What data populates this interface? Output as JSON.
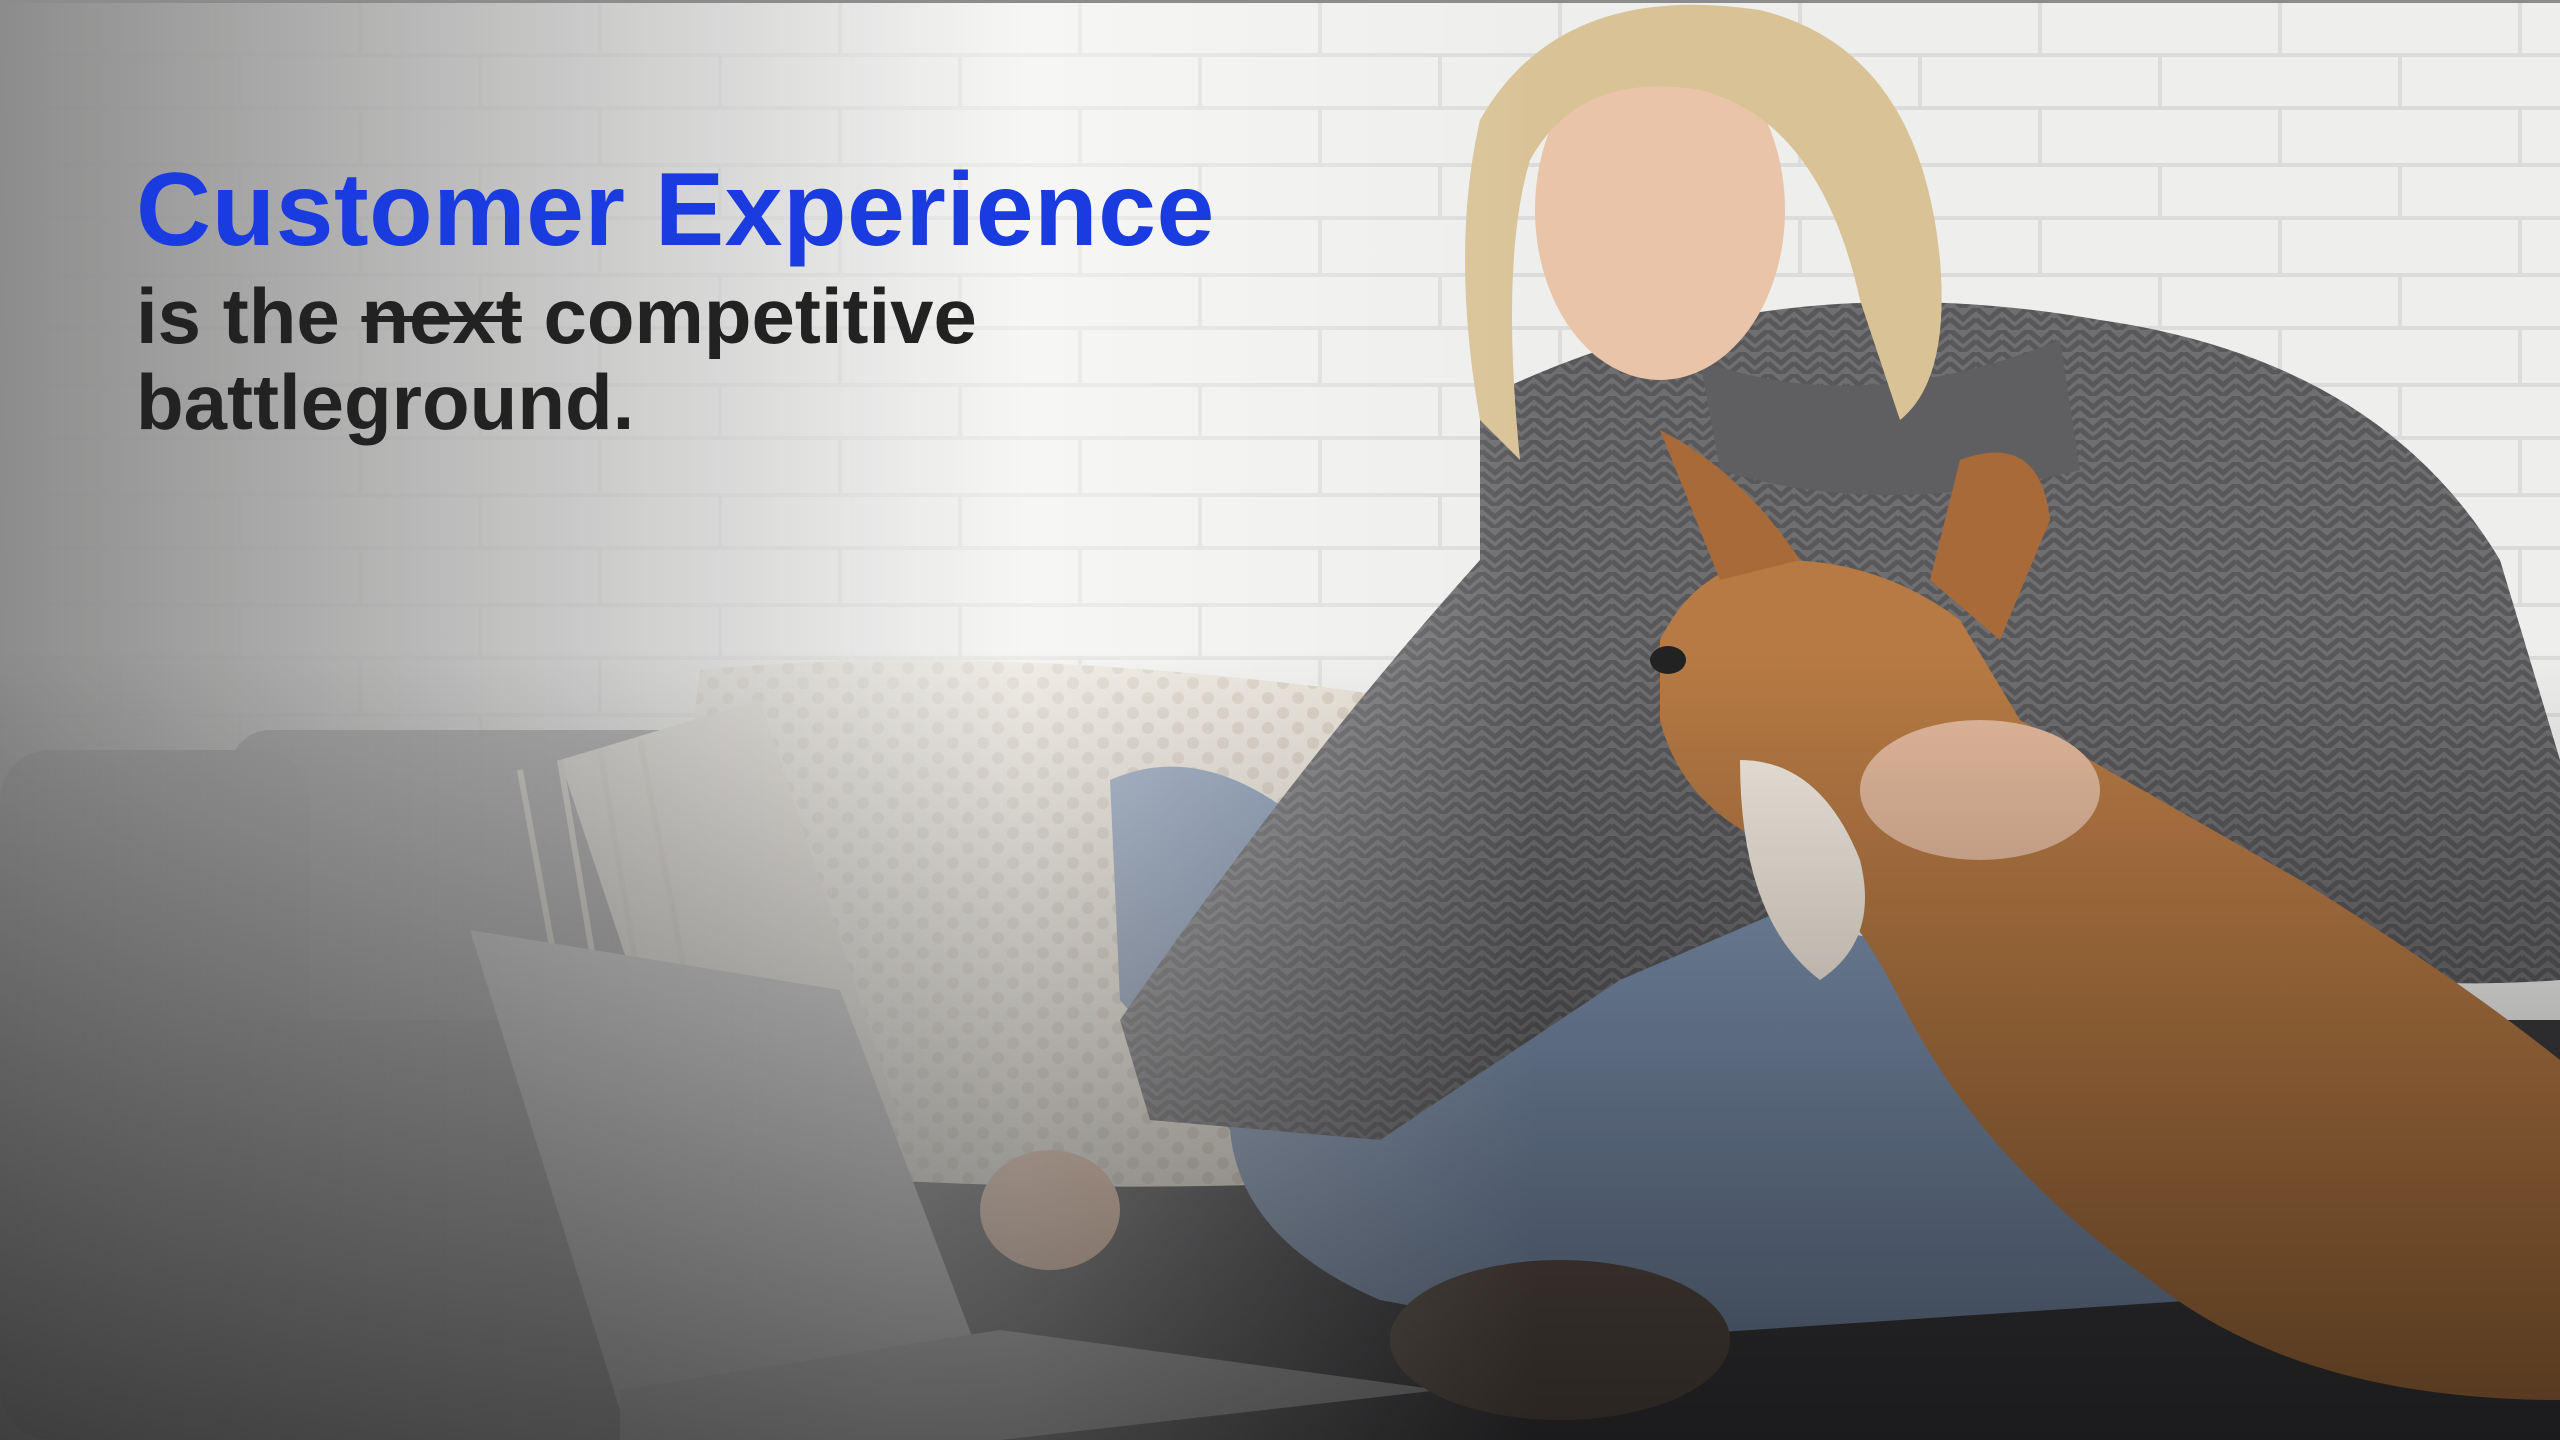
{
  "slide": {
    "title": "Customer Experience",
    "line1_before": "is the",
    "line1_struck": "next",
    "line1_after": "competitive",
    "line2": "battleground."
  },
  "colors": {
    "title": "#1a3be0",
    "body": "#222222",
    "wall": "#f2f2f0",
    "sofa": "#4a4a4c",
    "sweater": "#6e6e70",
    "jeans": "#7f93b0",
    "dog": "#b67a45",
    "blanket": "#e8e2d6",
    "laptop": "#9a9a9c"
  },
  "photo": {
    "description_icon": "woman-with-dog-laptop-photo"
  }
}
